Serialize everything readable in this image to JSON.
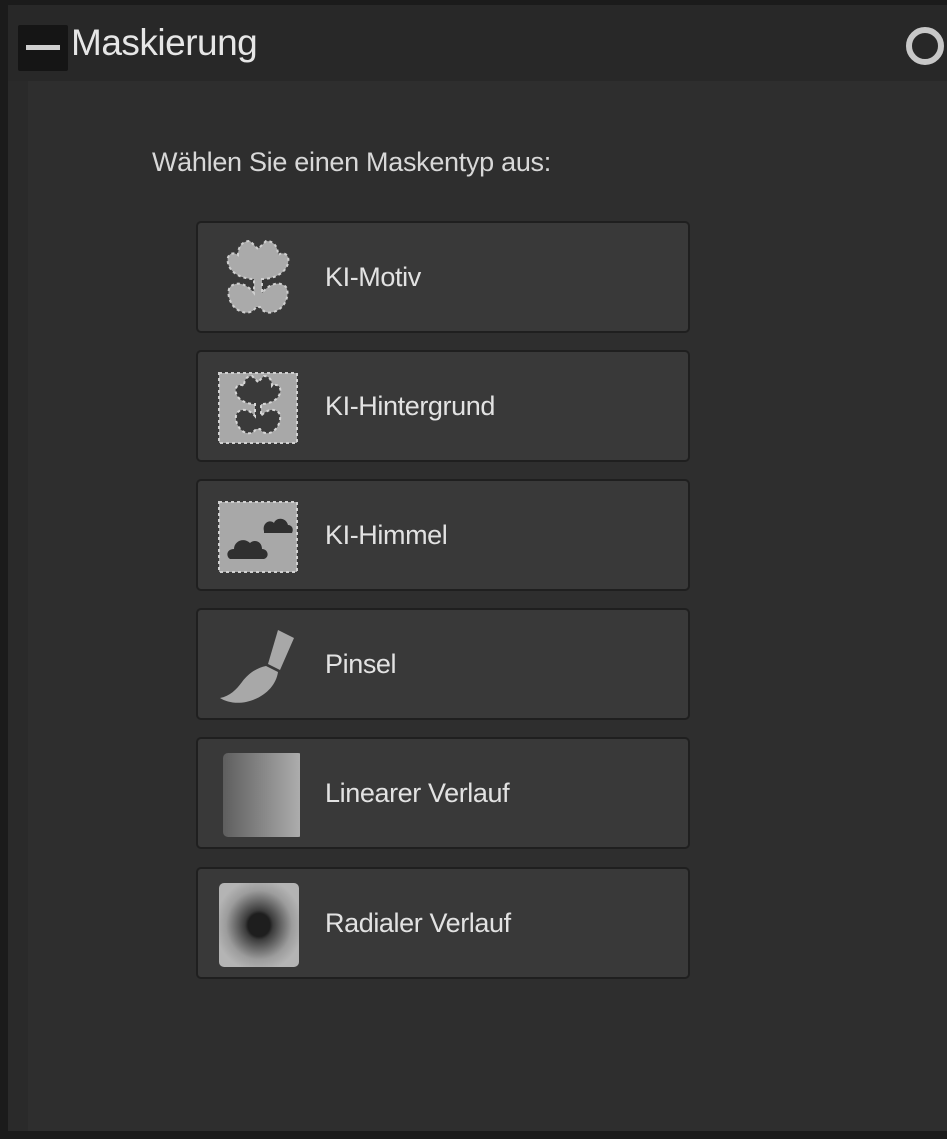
{
  "panel": {
    "title": "Maskierung",
    "prompt": "Wählen Sie einen Maskentyp aus:"
  },
  "mask_types": [
    {
      "label": "KI-Motiv",
      "icon": "flower-subject-icon"
    },
    {
      "label": "KI-Hintergrund",
      "icon": "flower-background-icon"
    },
    {
      "label": "KI-Himmel",
      "icon": "cloud-sky-icon"
    },
    {
      "label": "Pinsel",
      "icon": "brush-icon"
    },
    {
      "label": "Linearer Verlauf",
      "icon": "linear-gradient-icon"
    },
    {
      "label": "Radialer Verlauf",
      "icon": "radial-gradient-icon"
    }
  ],
  "colors": {
    "panel_background": "#2e2e2e",
    "button_background": "#393939",
    "text": "#e2e2e2",
    "icon": "#a8a8a8"
  }
}
